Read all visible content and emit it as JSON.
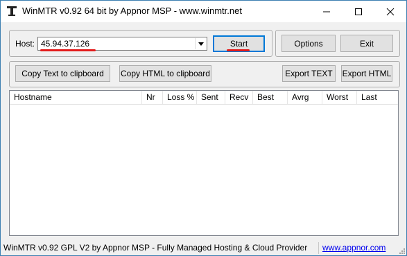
{
  "window": {
    "title": "WinMTR v0.92 64 bit by Appnor MSP - www.winmtr.net"
  },
  "host": {
    "label": "Host:",
    "value": "45.94.37.126"
  },
  "buttons": {
    "start": "Start",
    "options": "Options",
    "exit": "Exit",
    "copy_text": "Copy Text to clipboard",
    "copy_html": "Copy HTML to clipboard",
    "export_text": "Export TEXT",
    "export_html": "Export HTML"
  },
  "table": {
    "columns": [
      "Hostname",
      "Nr",
      "Loss %",
      "Sent",
      "Recv",
      "Best",
      "Avrg",
      "Worst",
      "Last"
    ],
    "rows": []
  },
  "status": {
    "text": "WinMTR v0.92 GPL V2 by Appnor MSP - Fully Managed Hosting & Cloud Provider",
    "link": "www.appnor.com"
  },
  "colors": {
    "annotation": "#e31b1b",
    "link": "#0000ee",
    "focus": "#0078d7"
  },
  "icons": [
    "app-icon",
    "minimize-icon",
    "maximize-icon",
    "close-icon",
    "dropdown-arrow-icon",
    "resize-grip-icon"
  ]
}
